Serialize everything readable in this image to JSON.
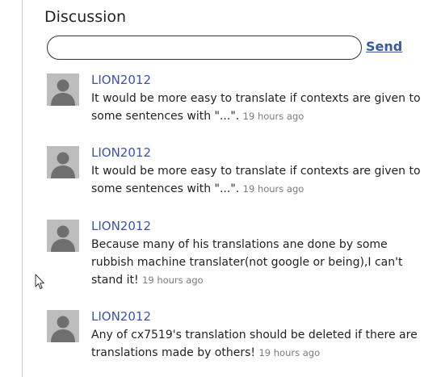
{
  "discussion": {
    "title": "Discussion",
    "input": {
      "value": "",
      "placeholder": ""
    },
    "send_label": "Send",
    "comments": [
      {
        "author": "LION2012",
        "text": "It would be more easy to translate if contexts are given to some sentences with \"...\".",
        "time": "19 hours ago"
      },
      {
        "author": "LION2012",
        "text": "It would be more easy to translate if contexts are given to some sentences with \"...\".",
        "time": "19 hours ago"
      },
      {
        "author": "LION2012",
        "text": "Because many of his translations ane done by some rubbish machine translater(not google or being),I can't stand it!",
        "time": "19 hours ago"
      },
      {
        "author": "LION2012",
        "text": "Any of cx7519's translation should be deleted if there are translations made by others!",
        "time": "19 hours ago"
      }
    ]
  }
}
